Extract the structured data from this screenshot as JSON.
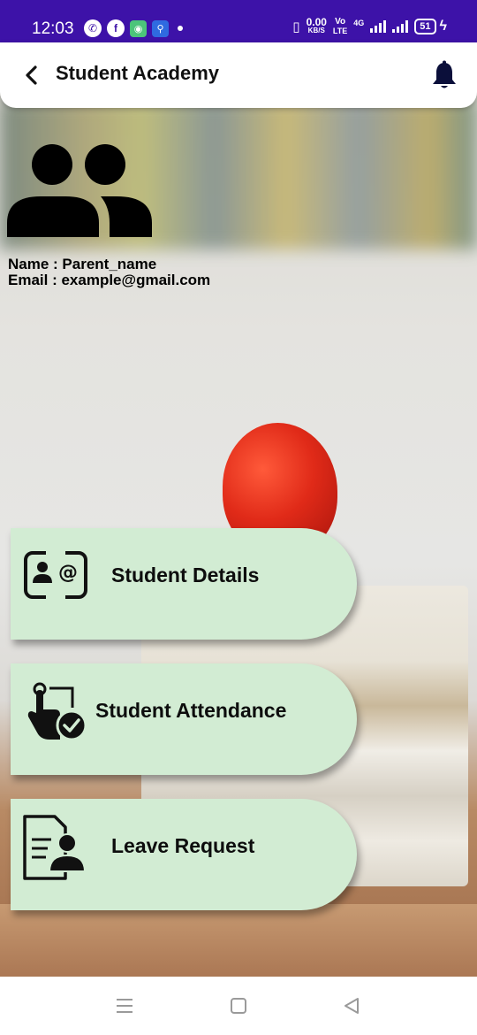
{
  "status_bar": {
    "time": "12:03",
    "net_speed_value": "0.00",
    "net_speed_unit": "KB/S",
    "volte_top": "Vo",
    "volte_bottom": "LTE",
    "network_type": "4G",
    "battery": "51",
    "left_icons": [
      "whatsapp-icon",
      "facebook-icon",
      "app-icon",
      "usb-icon"
    ],
    "right_icons": [
      "vibrate-icon",
      "signal-icon",
      "battery-icon",
      "charging-icon"
    ],
    "bg_color": "#3d12a8"
  },
  "header": {
    "title": "Student Academy",
    "back_icon": "chevron-left-icon",
    "bell_icon": "bell-icon",
    "bell_color": "#0b0f3a"
  },
  "profile": {
    "avatar_icon": "users-icon",
    "name_line": "Name : Parent_name",
    "email_line": "Email : example@gmail.com"
  },
  "menu": [
    {
      "label": "Student Details",
      "icon": "id-card-icon"
    },
    {
      "label": "Student Attendance",
      "icon": "touch-check-icon"
    },
    {
      "label": "Leave Request",
      "icon": "document-user-icon"
    }
  ],
  "menu_card_color": "#d2ecd3",
  "nav_bar": {
    "recents_icon": "menu-lines-icon",
    "home_icon": "square-icon",
    "back_icon": "triangle-back-icon"
  }
}
